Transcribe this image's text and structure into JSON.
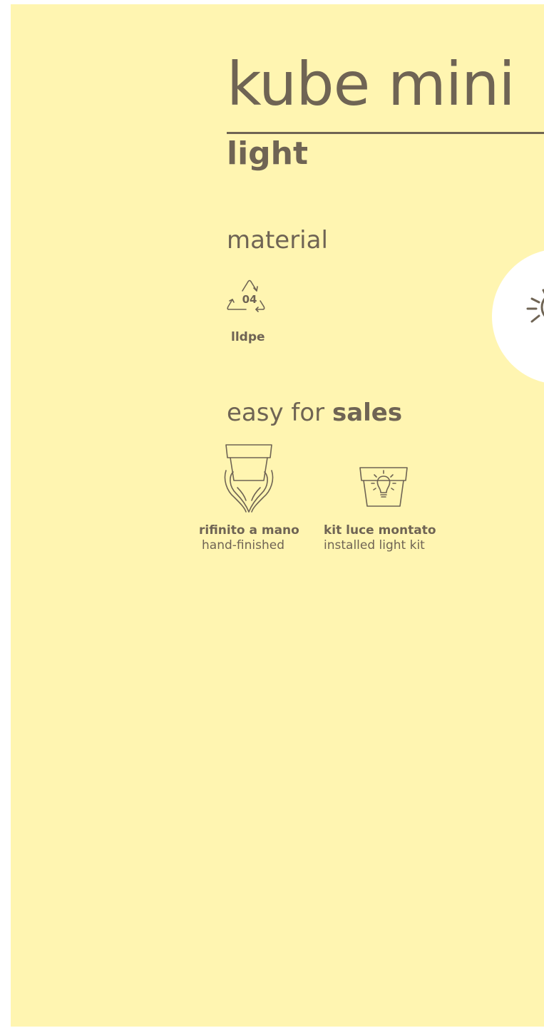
{
  "header": {
    "title": "kube mini",
    "subtitle": "light"
  },
  "material": {
    "heading": "material",
    "code": "04",
    "icon": "recycle-icon",
    "label": "lldpe"
  },
  "sales": {
    "heading_light": "easy for ",
    "heading_bold": "sales",
    "features": [
      {
        "icon": "hands-pot-icon",
        "label": "rifinito a mano",
        "sublabel": "hand-finished"
      },
      {
        "icon": "pot-bulb-icon",
        "label": "kit luce montato",
        "sublabel": "installed light kit"
      }
    ]
  },
  "badge": {
    "icon": "sun-icon"
  },
  "colors": {
    "background": "#fff5b1",
    "ink": "#6f6454",
    "badge": "#ffffff"
  }
}
